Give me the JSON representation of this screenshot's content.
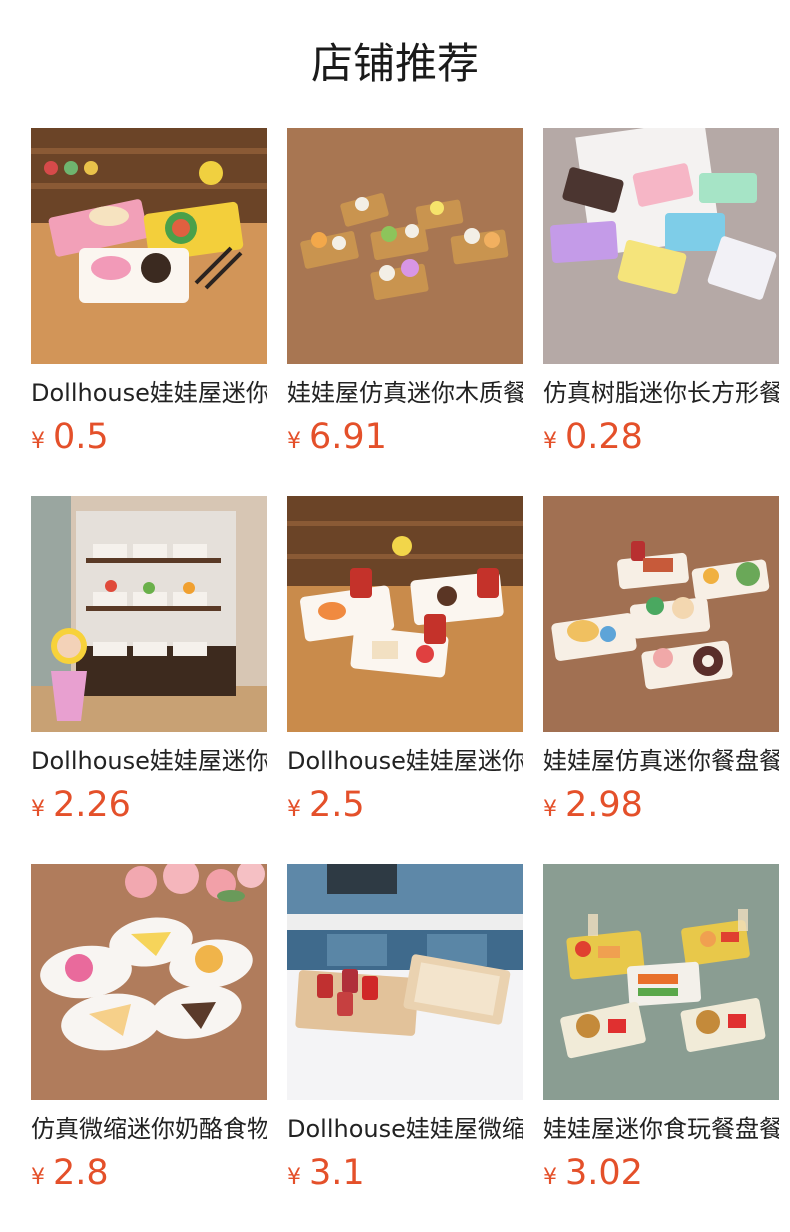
{
  "header": {
    "title": "店铺推荐"
  },
  "currency_symbol": "¥",
  "products": [
    {
      "name": "Dollhouse娃娃屋迷你",
      "price": "0.5"
    },
    {
      "name": "娃娃屋仿真迷你木质餐",
      "price": "6.91"
    },
    {
      "name": "仿真树脂迷你长方形餐",
      "price": "0.28"
    },
    {
      "name": "Dollhouse娃娃屋迷你",
      "price": "2.26"
    },
    {
      "name": "Dollhouse娃娃屋迷你",
      "price": "2.5"
    },
    {
      "name": "娃娃屋仿真迷你餐盘餐",
      "price": "2.98"
    },
    {
      "name": "仿真微缩迷你奶酪食物",
      "price": "2.8"
    },
    {
      "name": "Dollhouse娃娃屋微缩",
      "price": "3.1"
    },
    {
      "name": "娃娃屋迷你食玩餐盘餐",
      "price": "3.02"
    }
  ],
  "colors": {
    "price": "#e4502a",
    "title": "#1a1a1a"
  }
}
